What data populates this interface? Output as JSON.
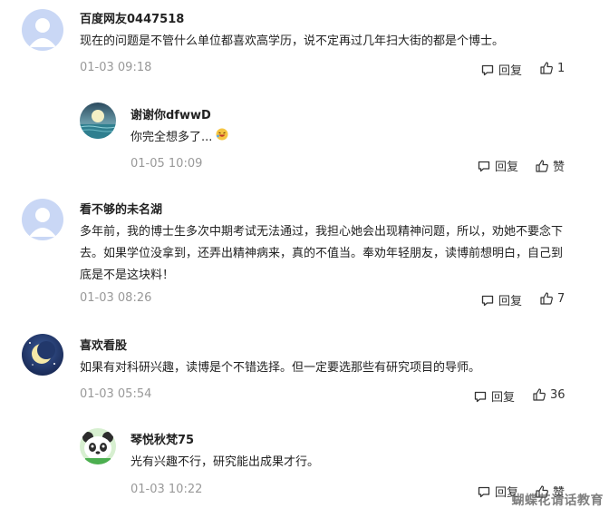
{
  "comments": [
    {
      "user": "百度网友0447518",
      "text": "现在的问题是不管什么单位都喜欢高学历，说不定再过几年扫大街的都是个博士。",
      "time": "01-03 09:18",
      "reply_label": "回复",
      "like_label": "1",
      "avatar_icon": "default-avatar-icon"
    },
    {
      "user": "谢谢你dfwwD",
      "text": "你完全想多了...",
      "time": "01-05 10:09",
      "reply_label": "回复",
      "like_label": "赞",
      "avatar_icon": "night-sea-avatar-icon",
      "emoji_icon": "laughing-emoji-icon"
    },
    {
      "user": "看不够的未名湖",
      "text": "多年前，我的博士生多次中期考试无法通过，我担心她会出现精神问题，所以，劝她不要念下去。如果学位没拿到，还弄出精神病来，真的不值当。奉劝年轻朋友，读博前想明白，自己到底是不是这块料！",
      "time": "01-03 08:26",
      "reply_label": "回复",
      "like_label": "7",
      "avatar_icon": "default-avatar-icon"
    },
    {
      "user": "喜欢看股",
      "text": "如果有对科研兴趣，读博是个不错选择。但一定要选那些有研究项目的导师。",
      "time": "01-03 05:54",
      "reply_label": "回复",
      "like_label": "36",
      "avatar_icon": "moon-avatar-icon"
    },
    {
      "user": "琴悦秋梵75",
      "text": "光有兴趣不行，研究能出成果才行。",
      "time": "01-03 10:22",
      "reply_label": "回复",
      "like_label": "赞",
      "avatar_icon": "panda-avatar-icon"
    }
  ],
  "watermark": "蝴蝶花请话教育",
  "colors": {
    "meta": "#999999",
    "text": "#222222",
    "avatar_default": "#c9d7f5"
  }
}
